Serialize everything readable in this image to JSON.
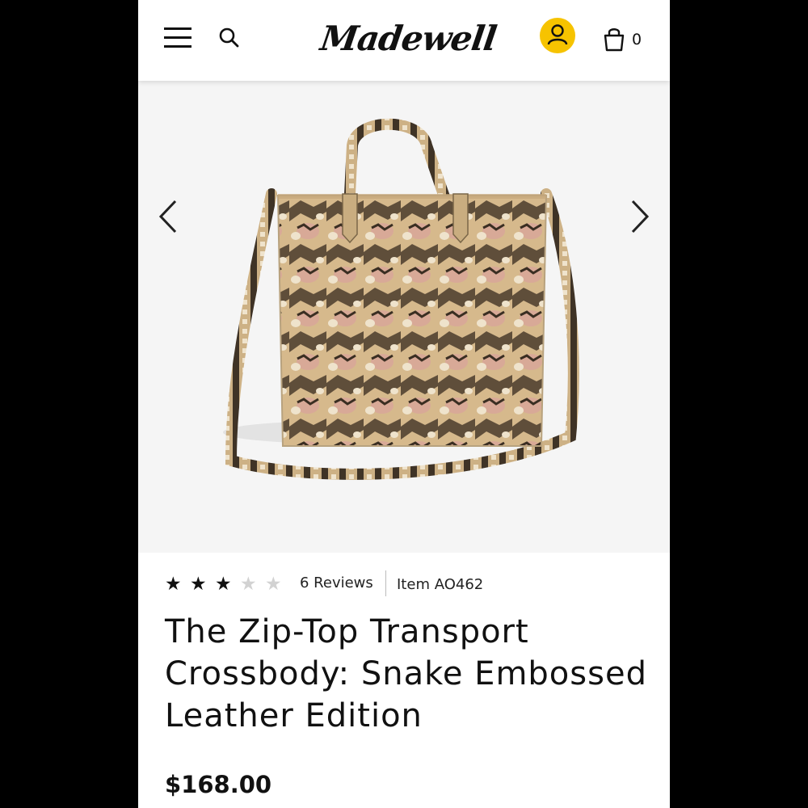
{
  "header": {
    "logo": "Madewell",
    "cart_count": "0",
    "icons": {
      "menu": "hamburger-icon",
      "search": "search-icon",
      "account": "user-icon",
      "bag": "shopping-bag-icon"
    },
    "account_color": "#f6c300"
  },
  "gallery": {
    "prev_icon": "chevron-left-icon",
    "next_icon": "chevron-right-icon"
  },
  "product": {
    "rating": {
      "value": 3,
      "max": 5
    },
    "reviews_label": "6 Reviews",
    "item_number": "Item AO462",
    "title": "The Zip-Top Transport Crossbody: Snake Embossed Leather Edition",
    "price": "$168.00"
  }
}
